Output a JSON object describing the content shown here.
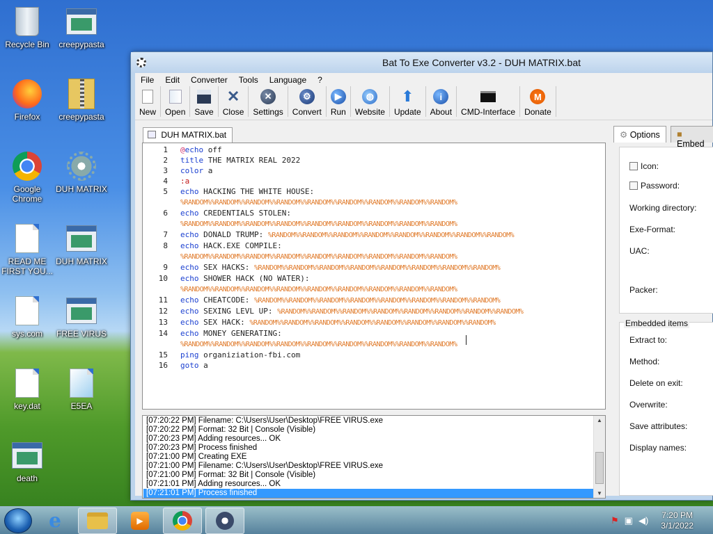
{
  "desktop": {
    "icons": [
      {
        "label": "Recycle Bin"
      },
      {
        "label": "creepypasta"
      },
      {
        "label": "Firefox"
      },
      {
        "label": "creepypasta"
      },
      {
        "label": "Google Chrome"
      },
      {
        "label": "DUH MATRIX"
      },
      {
        "label": "READ ME FIRST YOU..."
      },
      {
        "label": "DUH MATRIX"
      },
      {
        "label": "sys.com"
      },
      {
        "label": "FREE VIRUS"
      },
      {
        "label": "key.dat"
      },
      {
        "label": "E5EA"
      },
      {
        "label": "death"
      }
    ]
  },
  "window": {
    "title": "Bat To Exe Converter v3.2 - DUH MATRIX.bat",
    "menu": [
      "File",
      "Edit",
      "Converter",
      "Tools",
      "Language",
      "?"
    ],
    "toolbar": [
      "New",
      "Open",
      "Save",
      "Close",
      "Settings",
      "Convert",
      "Run",
      "Website",
      "Update",
      "About",
      "CMD-Interface",
      "Donate"
    ],
    "editor_tab": "DUH MATRIX.bat",
    "code_lines": [
      {
        "n": "1",
        "parts": [
          [
            "at",
            "@"
          ],
          [
            "kw",
            "echo"
          ],
          [
            "",
            "off"
          ]
        ]
      },
      {
        "n": "2",
        "parts": [
          [
            "kw",
            "title"
          ],
          [
            "",
            "THE MATRIX REAL 2022"
          ]
        ]
      },
      {
        "n": "3",
        "parts": [
          [
            "kw",
            "color"
          ],
          [
            "",
            "a"
          ]
        ]
      },
      {
        "n": "4",
        "parts": [
          [
            "lbl",
            ":a"
          ]
        ]
      },
      {
        "n": "5",
        "parts": [
          [
            "kw",
            "echo"
          ],
          [
            "",
            "HACKING THE WHITE HOUSE:"
          ]
        ]
      },
      {
        "n": "",
        "parts": [
          [
            "var",
            "%RANDOM%%RANDOM%%RANDOM%%RANDOM%%RANDOM%%RANDOM%%RANDOM%%RANDOM%%RANDOM%"
          ]
        ]
      },
      {
        "n": "6",
        "parts": [
          [
            "kw",
            "echo"
          ],
          [
            "",
            "CREDENTIALS STOLEN:"
          ]
        ]
      },
      {
        "n": "",
        "parts": [
          [
            "var",
            "%RANDOM%%RANDOM%%RANDOM%%RANDOM%%RANDOM%%RANDOM%%RANDOM%%RANDOM%%RANDOM%"
          ]
        ]
      },
      {
        "n": "7",
        "parts": [
          [
            "kw",
            "echo"
          ],
          [
            "",
            "DONALD TRUMP: "
          ],
          [
            "var",
            "%RANDOM%%RANDOM%%RANDOM%%RANDOM%%RANDOM%%RANDOM%%RANDOM%%RANDOM%"
          ]
        ]
      },
      {
        "n": "8",
        "parts": [
          [
            "kw",
            "echo"
          ],
          [
            "",
            "HACK.EXE COMPILE:"
          ]
        ]
      },
      {
        "n": "",
        "parts": [
          [
            "var",
            "%RANDOM%%RANDOM%%RANDOM%%RANDOM%%RANDOM%%RANDOM%%RANDOM%%RANDOM%%RANDOM%"
          ]
        ]
      },
      {
        "n": "9",
        "parts": [
          [
            "kw",
            "echo"
          ],
          [
            "",
            "SEX HACKS: "
          ],
          [
            "var",
            "%RANDOM%%RANDOM%%RANDOM%%RANDOM%%RANDOM%%RANDOM%%RANDOM%%RANDOM%"
          ]
        ]
      },
      {
        "n": "10",
        "parts": [
          [
            "kw",
            "echo"
          ],
          [
            "",
            "SHOWER HACK (NO WATER):"
          ]
        ]
      },
      {
        "n": "",
        "parts": [
          [
            "var",
            "%RANDOM%%RANDOM%%RANDOM%%RANDOM%%RANDOM%%RANDOM%%RANDOM%%RANDOM%%RANDOM%"
          ]
        ]
      },
      {
        "n": "11",
        "parts": [
          [
            "kw",
            "echo"
          ],
          [
            "",
            "CHEATCODE: "
          ],
          [
            "var",
            "%RANDOM%%RANDOM%%RANDOM%%RANDOM%%RANDOM%%RANDOM%%RANDOM%%RANDOM%"
          ]
        ]
      },
      {
        "n": "12",
        "parts": [
          [
            "kw",
            "echo"
          ],
          [
            "",
            "SEXING LEVL UP: "
          ],
          [
            "var",
            "%RANDOM%%RANDOM%%RANDOM%%RANDOM%%RANDOM%%RANDOM%%RANDOM%%RANDOM%"
          ]
        ]
      },
      {
        "n": "13",
        "parts": [
          [
            "kw",
            "echo"
          ],
          [
            "",
            "SEX HACK: "
          ],
          [
            "var",
            "%RANDOM%%RANDOM%%RANDOM%%RANDOM%%RANDOM%%RANDOM%%RANDOM%%RANDOM%"
          ]
        ]
      },
      {
        "n": "14",
        "parts": [
          [
            "kw",
            "echo"
          ],
          [
            "",
            "MONEY GENERATING:"
          ]
        ]
      },
      {
        "n": "",
        "parts": [
          [
            "var",
            "%RANDOM%%RANDOM%%RANDOM%%RANDOM%%RANDOM%%RANDOM%%RANDOM%%RANDOM%%RANDOM%"
          ]
        ]
      },
      {
        "n": "15",
        "parts": [
          [
            "kw",
            "ping"
          ],
          [
            "",
            "organiziation-fbi.com"
          ]
        ]
      },
      {
        "n": "16",
        "parts": [
          [
            "kw",
            "goto"
          ],
          [
            "",
            "a"
          ]
        ]
      }
    ],
    "log": [
      "[07:20:22 PM] Filename: C:\\Users\\User\\Desktop\\FREE VIRUS.exe",
      "[07:20:22 PM] Format: 32 Bit | Console (Visible)",
      "[07:20:23 PM] Adding resources... OK",
      "[07:20:23 PM] Process finished",
      "[07:21:00 PM] Creating EXE",
      "[07:21:00 PM] Filename: C:\\Users\\User\\Desktop\\FREE VIRUS.exe",
      "[07:21:00 PM] Format: 32 Bit | Console (Visible)",
      "[07:21:01 PM] Adding resources... OK",
      "[07:21:01 PM] Process finished"
    ],
    "right_panel": {
      "tabs": [
        "Options",
        "Embed"
      ],
      "options": {
        "icon_label": "Icon:",
        "password_label": "Password:",
        "working_dir_label": "Working directory:",
        "exe_format_label": "Exe-Format:",
        "uac_label": "UAC:",
        "packer_label": "Packer:"
      },
      "embedded": {
        "title": "Embedded items",
        "extract_to": "Extract to:",
        "method": "Method:",
        "delete_on_exit": "Delete on exit:",
        "overwrite": "Overwrite:",
        "save_attributes": "Save attributes:",
        "display_names": "Display names:"
      }
    }
  },
  "taskbar": {
    "time": "7:20 PM",
    "date": "3/1/2022"
  }
}
